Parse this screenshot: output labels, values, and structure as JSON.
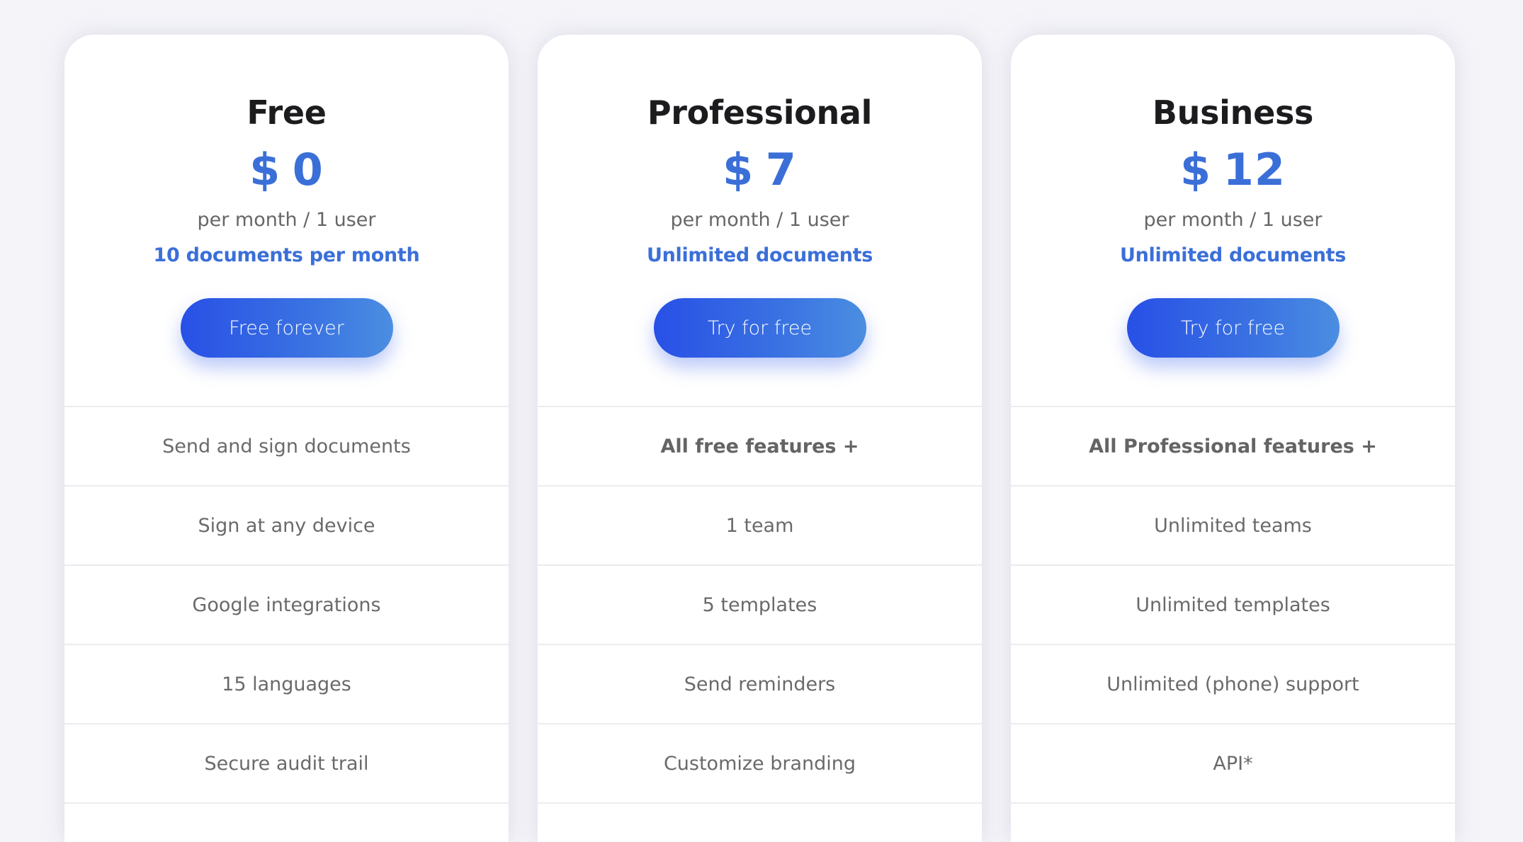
{
  "plans": [
    {
      "name": "Free",
      "price": "$ 0",
      "period": "per month / 1 user",
      "quota": "10 documents per month",
      "cta_label": "Free forever",
      "features": [
        {
          "text": "Send and sign documents",
          "bold": false
        },
        {
          "text": "Sign at any device",
          "bold": false
        },
        {
          "text": "Google integrations",
          "bold": false
        },
        {
          "text": "15 languages",
          "bold": false
        },
        {
          "text": "Secure audit trail",
          "bold": false
        }
      ]
    },
    {
      "name": "Professional",
      "price": "$ 7",
      "period": "per month / 1 user",
      "quota": "Unlimited documents",
      "cta_label": "Try for free",
      "features": [
        {
          "text": "All free features +",
          "bold": true
        },
        {
          "text": "1 team",
          "bold": false
        },
        {
          "text": "5 templates",
          "bold": false
        },
        {
          "text": "Send reminders",
          "bold": false
        },
        {
          "text": "Customize branding",
          "bold": false
        }
      ]
    },
    {
      "name": "Business",
      "price": "$ 12",
      "period": "per month / 1 user",
      "quota": "Unlimited documents",
      "cta_label": "Try for free",
      "features": [
        {
          "text": "All Professional features +",
          "bold": true
        },
        {
          "text": "Unlimited teams",
          "bold": false
        },
        {
          "text": "Unlimited templates",
          "bold": false
        },
        {
          "text": "Unlimited (phone) support",
          "bold": false
        },
        {
          "text": "API*",
          "bold": false
        }
      ]
    }
  ],
  "colors": {
    "accent": "#3b6fd8",
    "button_gradient_start": "#2850e6",
    "button_gradient_end": "#4b8ee1",
    "background": "#f4f4f9",
    "feature_text": "#6a6a6c"
  }
}
